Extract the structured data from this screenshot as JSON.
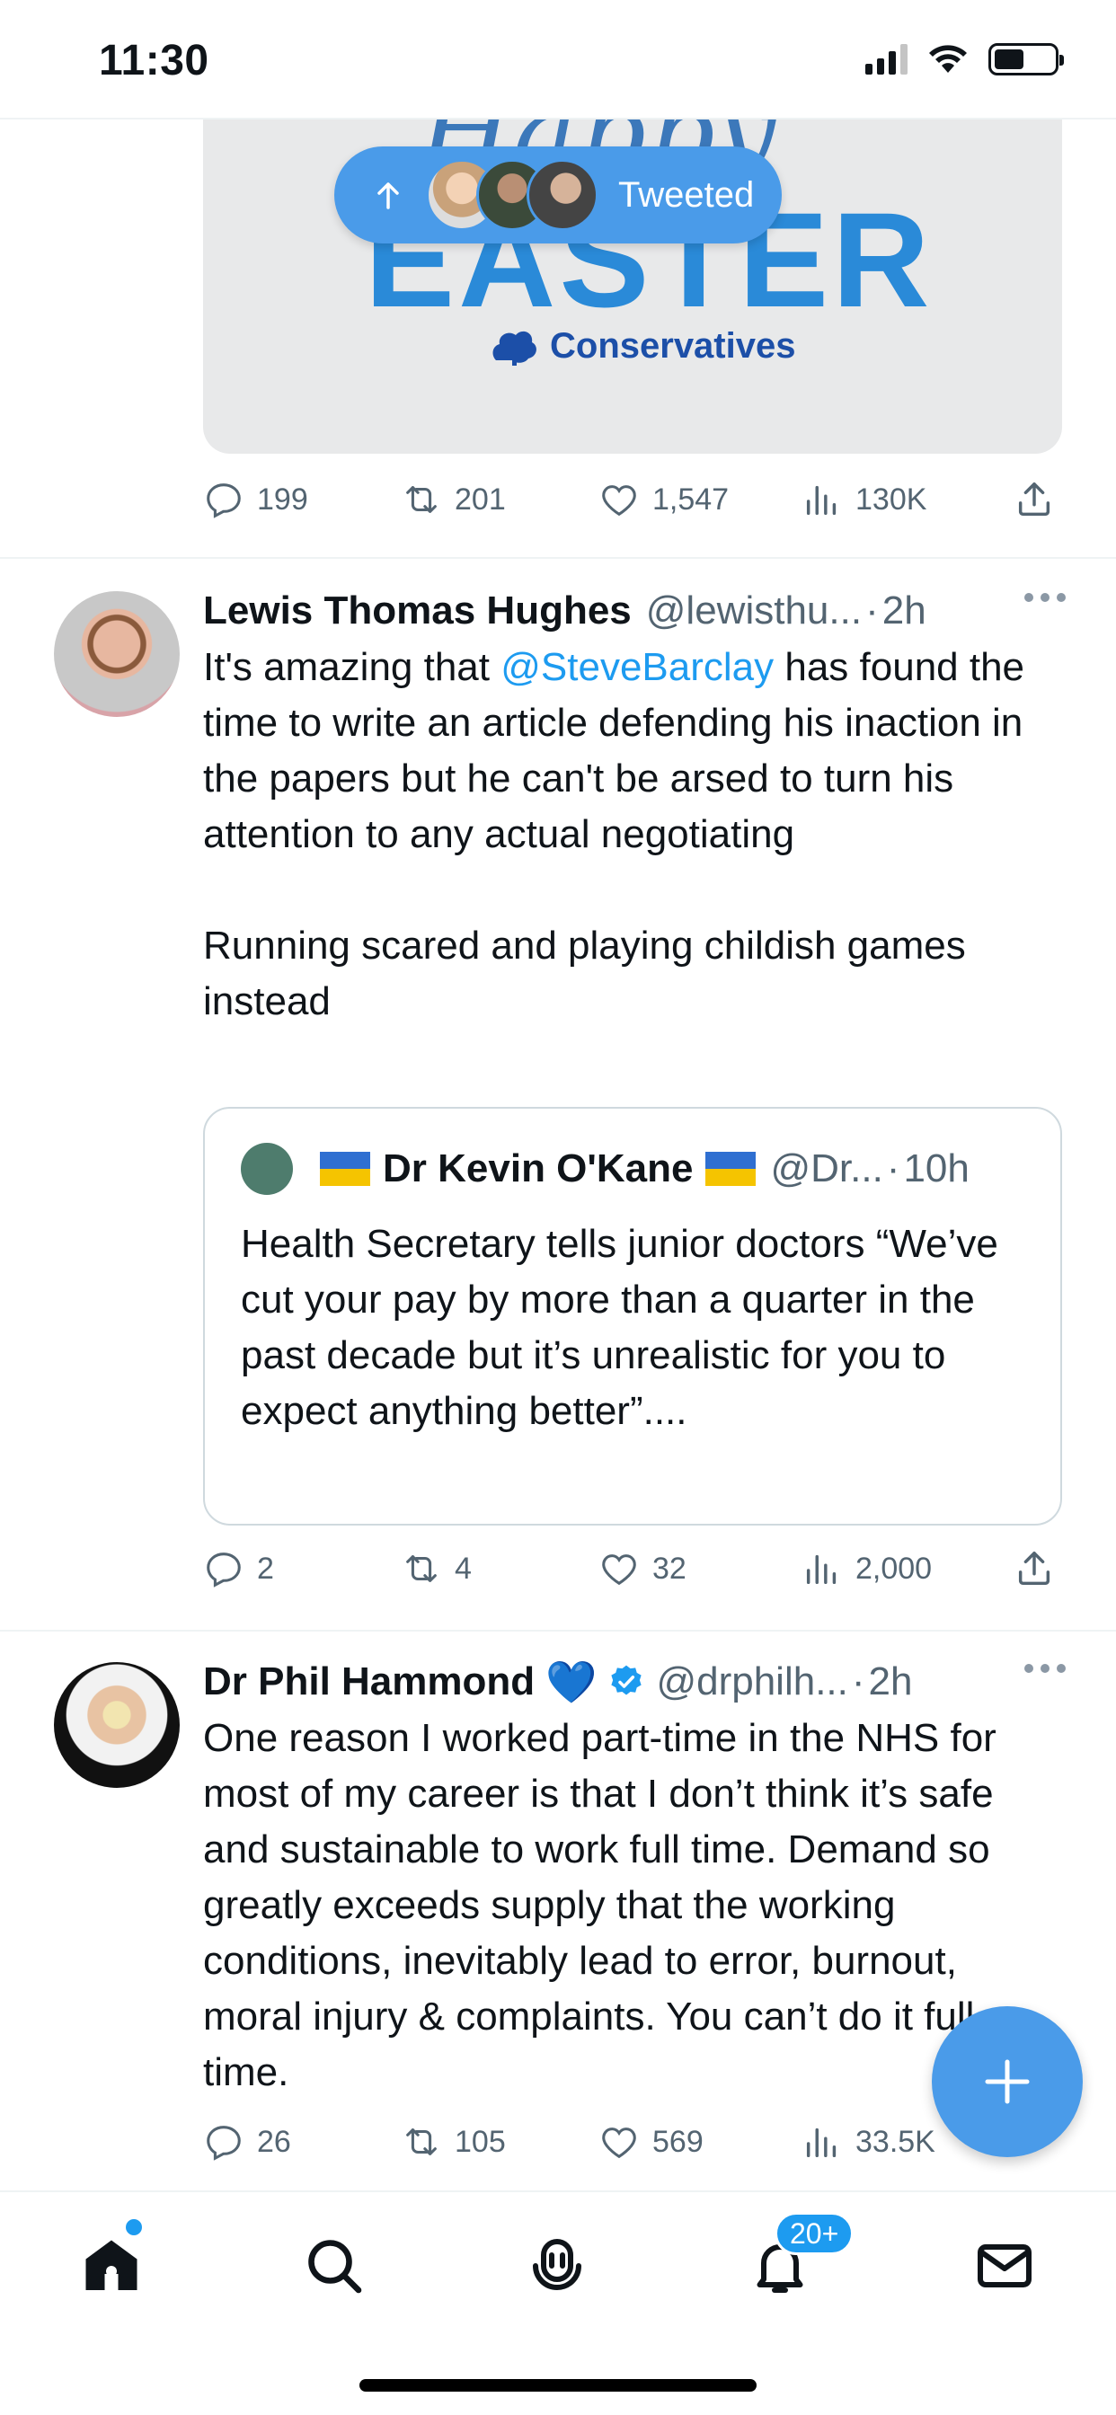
{
  "status_bar": {
    "time": "11:30"
  },
  "media": {
    "script_text": "Happy",
    "headline": "EASTER",
    "brand": "Conservatives"
  },
  "tweeted_pill": {
    "label": "Tweeted"
  },
  "tweet0": {
    "actions": {
      "replies": "199",
      "retweets": "201",
      "likes": "1,547",
      "views": "130K"
    }
  },
  "tweet1": {
    "author": "Lewis Thomas Hughes",
    "handle": "@lewisthu...",
    "time": "2h",
    "text_before_mention": "It's amazing that ",
    "mention": "@SteveBarclay",
    "text_after_mention": " has found the time to write an article defending his inaction in the papers but he can't be arsed to turn his attention to any actual negotiating\n\nRunning scared and playing childish games instead",
    "quote": {
      "author": "Dr Kevin O'Kane",
      "handle": "@Dr...",
      "time": "10h",
      "text": "Health Secretary tells junior doctors “We’ve cut your pay by more than a quarter in the past decade but it’s unrealistic for you to expect anything better”...."
    },
    "actions": {
      "replies": "2",
      "retweets": "4",
      "likes": "32",
      "views": "2,000"
    }
  },
  "tweet2": {
    "author": "Dr Phil Hammond",
    "emoji": "💙",
    "handle": "@drphilh...",
    "time": "2h",
    "text": "One reason I worked part-time in the NHS for most of my career is that I don’t think it’s safe and sustainable to work full time. Demand so greatly exceeds supply that the working conditions, inevitably lead to error, burnout, moral injury & complaints. You can’t do it full time.",
    "actions": {
      "replies": "26",
      "retweets": "105",
      "likes": "569",
      "views": "33.5K"
    }
  },
  "bottom_nav": {
    "notifications_badge": "20+"
  },
  "colors": {
    "accent": "#1d9bf0",
    "fab": "#4a9be9",
    "muted": "#536471"
  }
}
